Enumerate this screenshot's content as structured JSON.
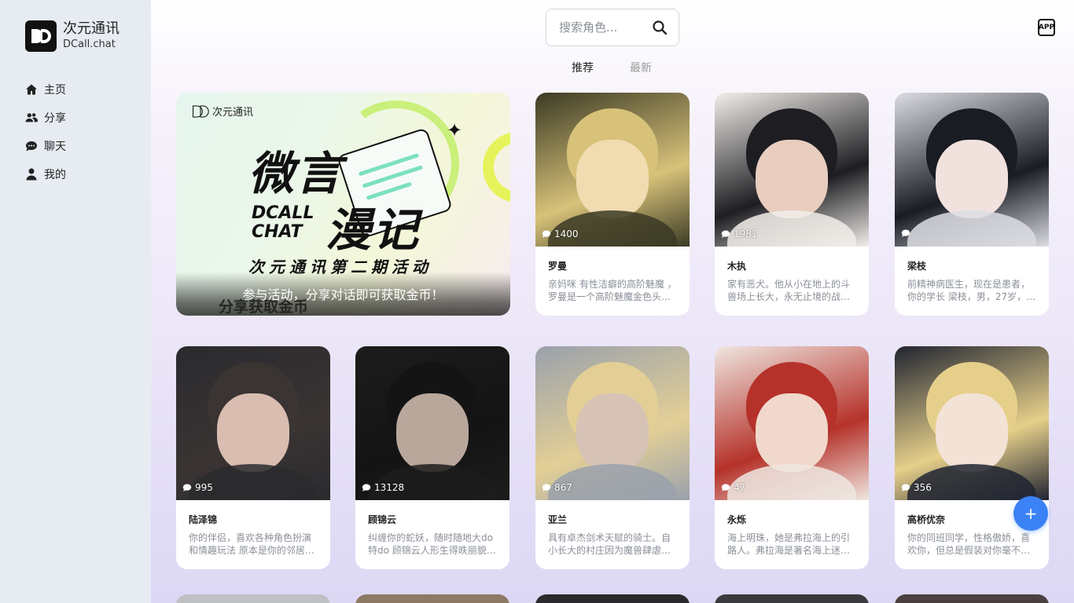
{
  "brand": {
    "name": "次元通讯",
    "sub": "DCall.chat"
  },
  "nav": [
    {
      "label": "主页",
      "icon": "home-icon"
    },
    {
      "label": "分享",
      "icon": "users-icon"
    },
    {
      "label": "聊天",
      "icon": "chat-icon"
    },
    {
      "label": "我的",
      "icon": "user-icon"
    }
  ],
  "search": {
    "placeholder": "搜索角色..."
  },
  "app_badge": "APP",
  "tabs": [
    {
      "label": "推荐",
      "active": true
    },
    {
      "label": "最新",
      "active": false
    }
  ],
  "banner": {
    "logo_text": "次元通讯",
    "title1": "微言",
    "title2": "漫记",
    "en": "DCALL\nCHAT",
    "subtitle": "次元通讯第二期活动",
    "caption": "参与活动，分享对话即可获取金币！",
    "ghost": "分享获取金币"
  },
  "cards": [
    {
      "name": "罗曼",
      "count": "1400",
      "desc": "亲妈咪 有性洁癖的高阶魅魔 ，罗曼是一个高阶魅魔金色头发…",
      "palette": [
        "#d8c27a",
        "#f0dcb0",
        "#3b3a24"
      ]
    },
    {
      "name": "木执",
      "count": "1981",
      "desc": "家有恶犬。他从小在地上的斗兽场上长大，永无止境的战斗…",
      "palette": [
        "#1e1e22",
        "#e9cdbf",
        "#f2eeea"
      ]
    },
    {
      "name": "梁枝",
      "count": "",
      "desc": "前精神病医生，现在是患者，你的学长 梁枝，男，27岁，…",
      "palette": [
        "#1a1c24",
        "#f1e2de",
        "#dcdde3"
      ]
    },
    {
      "name": "陆泽锦",
      "count": "995",
      "desc": "你的伴侣，喜欢各种角色扮演和情趣玩法 原本是你的邻居…",
      "palette": [
        "#3a3433",
        "#d9bdb0",
        "#2a2a2e"
      ]
    },
    {
      "name": "顾锦云",
      "count": "13128",
      "desc": "纠缠你的蛇妖，随时随地大do特do 顾锦云人形生得昳丽貌…",
      "palette": [
        "#141414",
        "#b9a79c",
        "#1c1c1c"
      ]
    },
    {
      "name": "亚兰",
      "count": "867",
      "desc": "具有卓杰剑术天赋的骑士。自小长大的村庄因为魔兽肆虐…",
      "palette": [
        "#e3cf96",
        "#d6c3b5",
        "#9aa1ac"
      ]
    },
    {
      "name": "永烁",
      "count": "47",
      "desc": "海上明珠，她是弗拉海上的引路人。弗拉海是著名海上迷…",
      "palette": [
        "#b5322a",
        "#f0d9cc",
        "#efe6e0"
      ]
    },
    {
      "name": "高桥优奈",
      "count": "356",
      "desc": "你的同班同学，性格傲娇，喜欢你，但总是假装对你毫不…",
      "palette": [
        "#e6cf8a",
        "#f3e2d6",
        "#202431"
      ]
    }
  ],
  "fab_label": "+"
}
